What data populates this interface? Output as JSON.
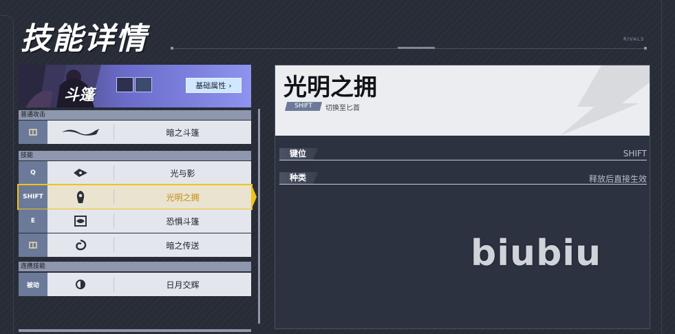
{
  "page": {
    "title": "技能详情",
    "brand_tag": "RIVALS"
  },
  "hero": {
    "name": "斗篷",
    "base_attr_label": "基础属性",
    "base_attr_arrow": "›"
  },
  "sections": {
    "normal": "普通攻击",
    "skills": "技能",
    "team": "连携技能"
  },
  "skills": [
    {
      "key": "",
      "key_icon": "book-icon",
      "icon": "dagger-wave-icon",
      "name": "暗之斗篷"
    },
    {
      "key": "Q",
      "key_icon": "",
      "icon": "eye-dart-icon",
      "name": "光与影"
    },
    {
      "key": "SHIFT",
      "key_icon": "",
      "icon": "hooded-figure-icon",
      "name": "光明之拥",
      "selected": true
    },
    {
      "key": "E",
      "key_icon": "",
      "icon": "eye-frame-icon",
      "name": "恐惧斗篷"
    },
    {
      "key": "",
      "key_icon": "book-icon",
      "icon": "swirl-teleport-icon",
      "name": "暗之传送"
    },
    {
      "key": "被动",
      "key_icon": "",
      "icon": "sun-moon-icon",
      "name": "日月交辉"
    }
  ],
  "detail": {
    "title": "光明之拥",
    "badge": "SHIFT",
    "switch_text": "切换至匕首",
    "props": [
      {
        "label": "键位",
        "value": "SHIFT"
      },
      {
        "label": "种类",
        "value": "释放后直接生效"
      }
    ]
  },
  "watermark": "biubiu",
  "colors": {
    "accent_gold": "#f0c419",
    "key_bg": "#6c7a99",
    "page_bg": "#272c37"
  }
}
